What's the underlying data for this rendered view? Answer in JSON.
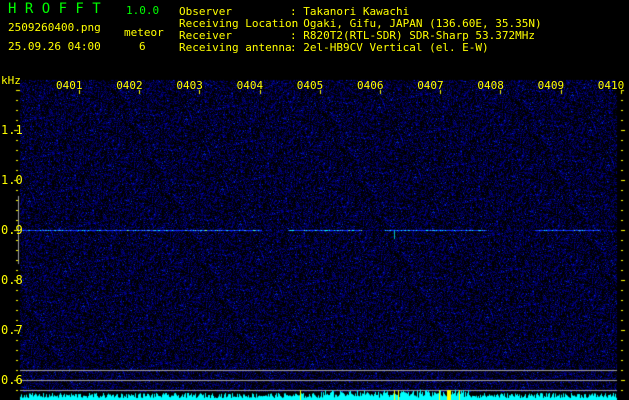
{
  "app": {
    "title": "H R O F F T",
    "version": "1.0.0"
  },
  "file": {
    "name": "2509260400.png",
    "datetime": "25.09.26 04:00"
  },
  "meteor": {
    "label": "meteor",
    "count": "6"
  },
  "info": [
    {
      "label": "Observer",
      "value": ": Takanori Kawachi"
    },
    {
      "label": "Receiving Location",
      "value": ": Ogaki, Gifu, JAPAN (136.60E, 35.35N)"
    },
    {
      "label": "Receiver",
      "value": ": R820T2(RTL-SDR) SDR-Sharp 53.372MHz"
    },
    {
      "label": "Receiving antenna",
      "value": ": 2el-HB9CV Vertical (el. E-W)"
    }
  ],
  "axis": {
    "unit": "kHz",
    "freq_labels": [
      "1.1",
      "1.0",
      "0.9",
      "0.8",
      "0.7",
      "0.6"
    ],
    "freq_values": [
      1.1,
      1.0,
      0.9,
      0.8,
      0.7,
      0.6
    ],
    "time_labels": [
      "0401",
      "0402",
      "0403",
      "0404",
      "0405",
      "0406",
      "0407",
      "0408",
      "0409",
      "0410"
    ]
  },
  "colors": {
    "text": "#ffff00",
    "title": "#00ff00",
    "signal": "#00ffff",
    "noise": "#0000c0",
    "guide_lines": "#a0a0a0"
  },
  "signal": {
    "carrier_khz": 0.9
  }
}
